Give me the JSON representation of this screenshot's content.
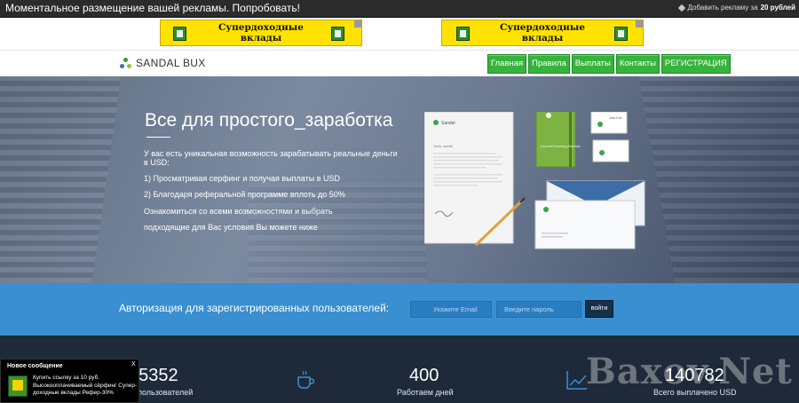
{
  "topbar": {
    "promo_text": "Моментальное размещение вашей рекламы. Попробовать!",
    "add_ad_prefix": "Добавить рекламу за",
    "add_ad_price": "20 рублей"
  },
  "banners": [
    {
      "line1": "Супердоходные",
      "line2": "вклады"
    },
    {
      "line1": "Супердоходные",
      "line2": "вклады"
    }
  ],
  "logo": {
    "text": "SANDAL BUX"
  },
  "menu": [
    "Главная",
    "Правила",
    "Выплаты",
    "Контакты",
    "РЕГИСТРАЦИЯ"
  ],
  "hero": {
    "title": "Все для простого_заработка",
    "line1": "У вас есть уникальная возможность зарабатывать реальные деньги",
    "line2": "в USD:",
    "point1": "1) Просматривая серфинг и получая выплаты в USD",
    "point2": "2) Благодаря реферальной программе вплоть до 50%",
    "line3": "Ознакомиться со всеми возможностями и выбрать",
    "line4": "подходящие для Вас условия Вы можете ниже"
  },
  "mockup": {
    "brand": "Sandal",
    "letter_greeting": "Hello, world!",
    "notebook_text": "Corporate Branding Materials",
    "card_name": "Jack Doe"
  },
  "login": {
    "label": "Авторизация для зарегистрированных пользователей:",
    "email_placeholder": "Укажите Email",
    "password_placeholder": "Введите пароль",
    "submit_label": "войти"
  },
  "stats": [
    {
      "value": "25352",
      "label": "Всего пользователей"
    },
    {
      "value": "400",
      "label": "Работаем дней"
    },
    {
      "value": "140782",
      "label": "Всего выплачено USD"
    }
  ],
  "watermark": "Baxov.Net",
  "popup": {
    "title": "Новое сообщение",
    "close": "X",
    "message": "Купить ссылку за 10 руб. Высокооплачиваемый сёрфинг Супер-доходные вклады Рефер-30%"
  },
  "colors": {
    "menu_green": "#36b33c",
    "login_blue": "#3a8fd0",
    "stats_bg": "#1e2a3a",
    "banner_yellow": "#ffe200"
  }
}
